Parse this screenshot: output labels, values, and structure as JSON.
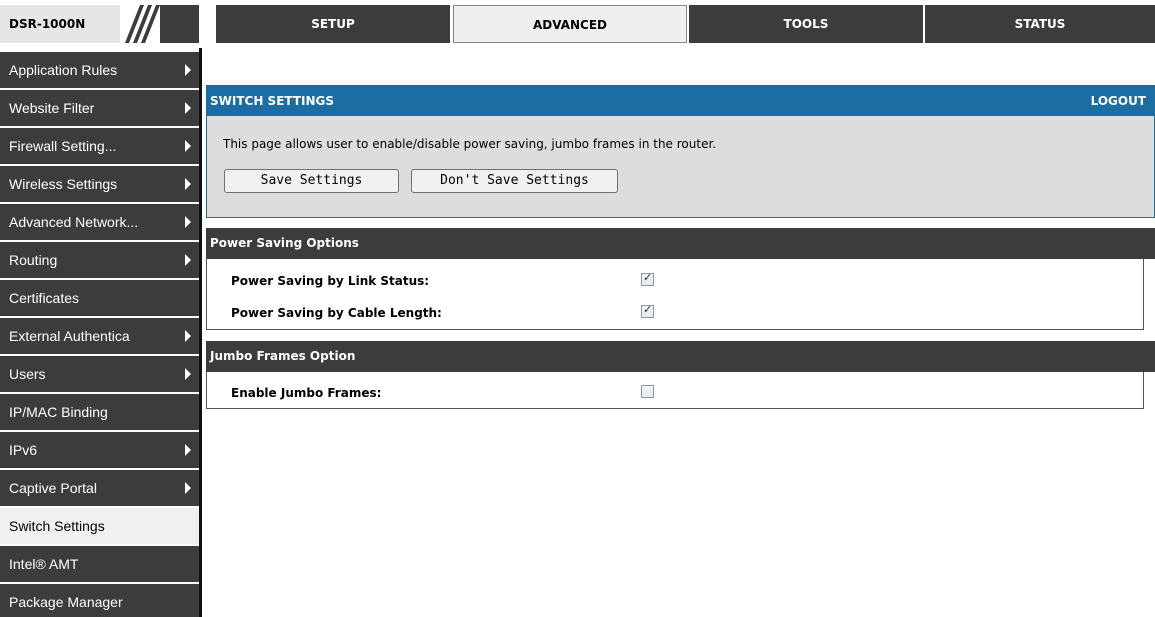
{
  "header": {
    "model": "DSR-1000N",
    "tabs": [
      {
        "label": "SETUP"
      },
      {
        "label": "ADVANCED"
      },
      {
        "label": "TOOLS"
      },
      {
        "label": "STATUS"
      }
    ],
    "active_tab": "ADVANCED"
  },
  "sidebar": {
    "items": [
      {
        "label": "Application Rules",
        "has_arrow": true
      },
      {
        "label": "Website Filter",
        "has_arrow": true
      },
      {
        "label": "Firewall Setting...",
        "has_arrow": true
      },
      {
        "label": "Wireless Settings",
        "has_arrow": true
      },
      {
        "label": "Advanced Network...",
        "has_arrow": true
      },
      {
        "label": "Routing",
        "has_arrow": true
      },
      {
        "label": "Certificates",
        "has_arrow": false
      },
      {
        "label": "External Authentica",
        "has_arrow": true
      },
      {
        "label": "Users",
        "has_arrow": true
      },
      {
        "label": "IP/MAC Binding",
        "has_arrow": false
      },
      {
        "label": "IPv6",
        "has_arrow": true
      },
      {
        "label": "Captive Portal",
        "has_arrow": true
      },
      {
        "label": "Switch Settings",
        "has_arrow": false
      },
      {
        "label": "Intel® AMT",
        "has_arrow": false
      },
      {
        "label": "Package Manager",
        "has_arrow": false
      }
    ],
    "active_item": "Switch Settings"
  },
  "panel": {
    "title": "SWITCH SETTINGS",
    "logout": "LOGOUT",
    "description": "This page allows user to enable/disable power saving, jumbo frames in the router.",
    "save_label": "Save Settings",
    "dont_save_label": "Don't Save Settings"
  },
  "power_saving": {
    "title": "Power Saving Options",
    "link_status_label": "Power Saving by Link Status:",
    "link_status_checked": true,
    "cable_length_label": "Power Saving by Cable Length:",
    "cable_length_checked": true
  },
  "jumbo": {
    "title": "Jumbo Frames Option",
    "enable_label": "Enable Jumbo Frames:",
    "enable_checked": false
  },
  "colors": {
    "dark": "#3c3c3c",
    "panel_head": "#1c6da3",
    "panel_bg": "#dddddd"
  }
}
